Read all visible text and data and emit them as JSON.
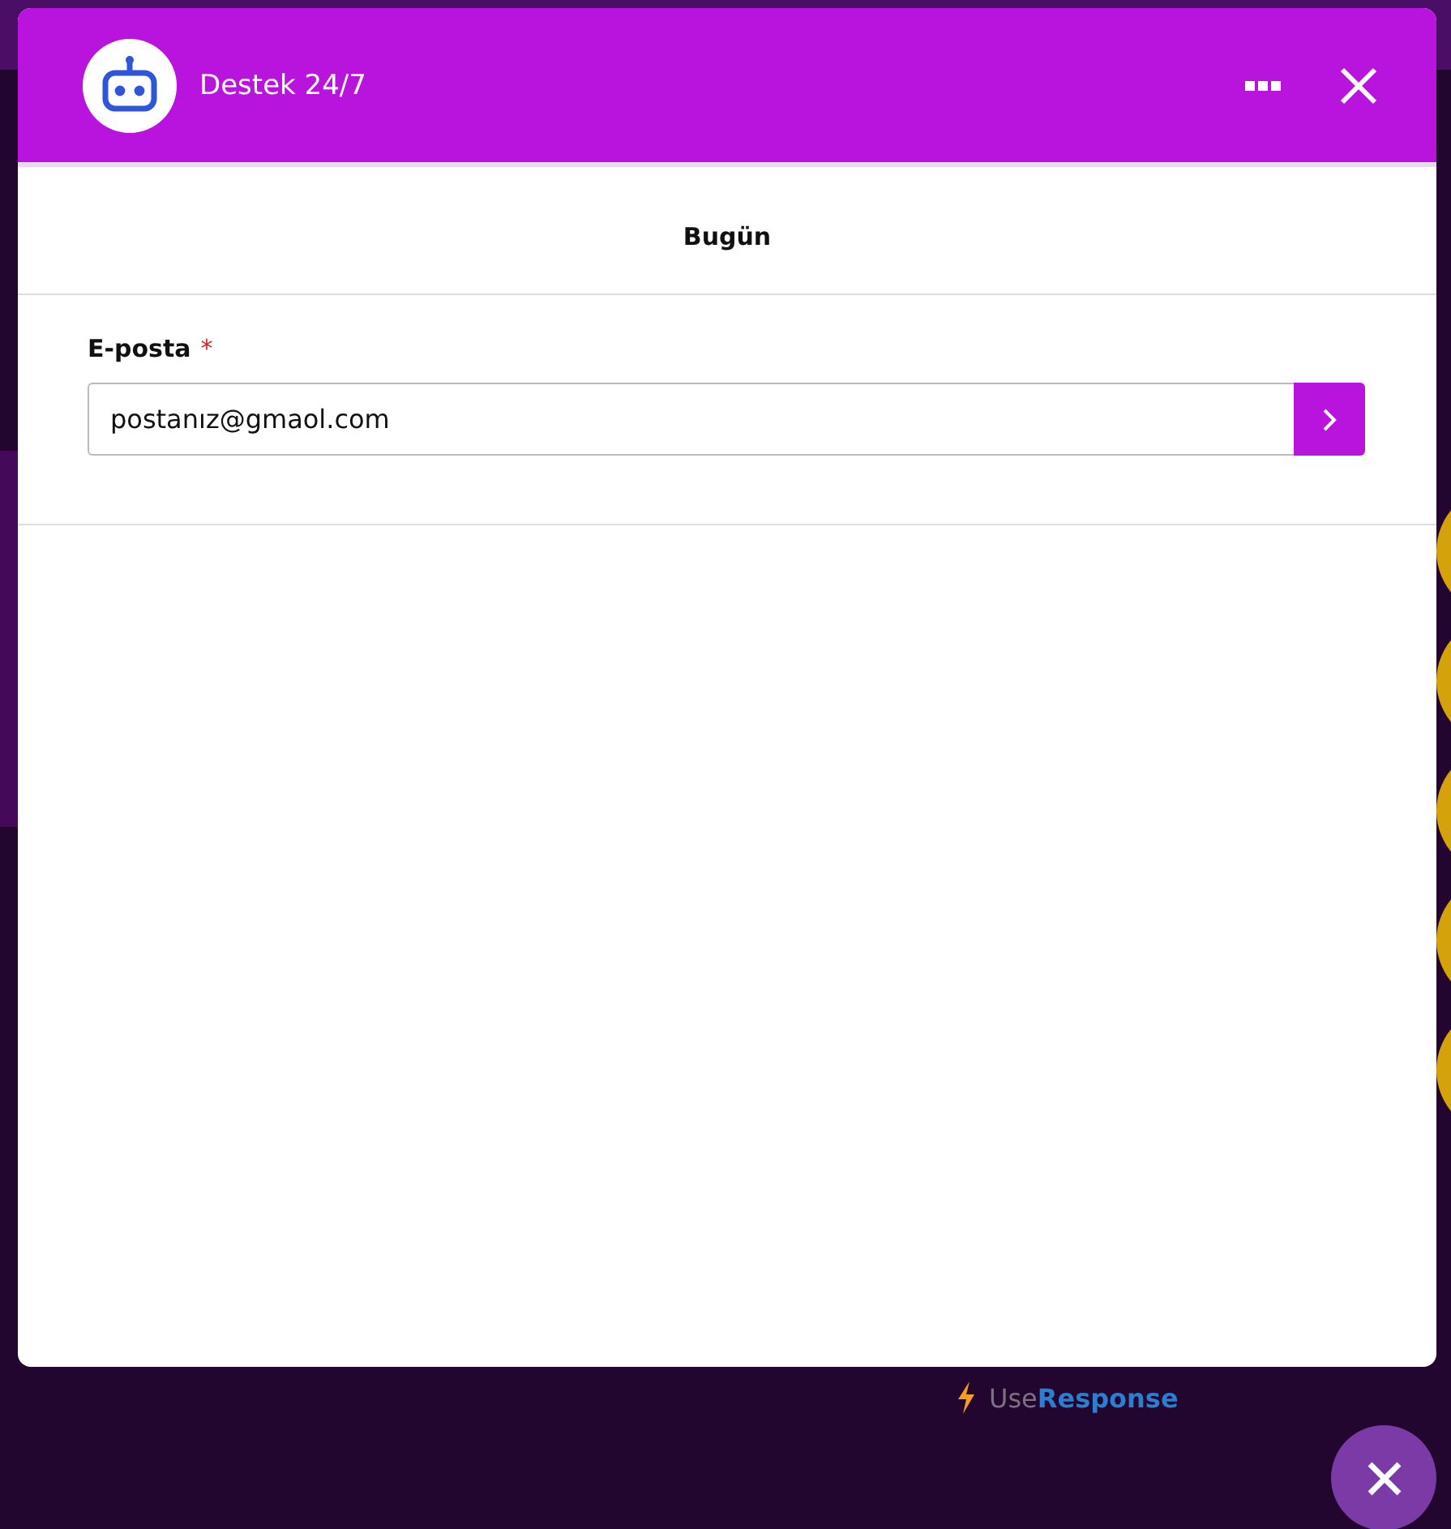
{
  "chat_window": {
    "title": "Destek 24/7",
    "date_divider": "Bugün",
    "email_field": {
      "label": "E-posta",
      "required_mark": "*",
      "value": "postanız@gmaol.com"
    }
  },
  "branding": {
    "prefix": "Use",
    "name": "Response"
  }
}
